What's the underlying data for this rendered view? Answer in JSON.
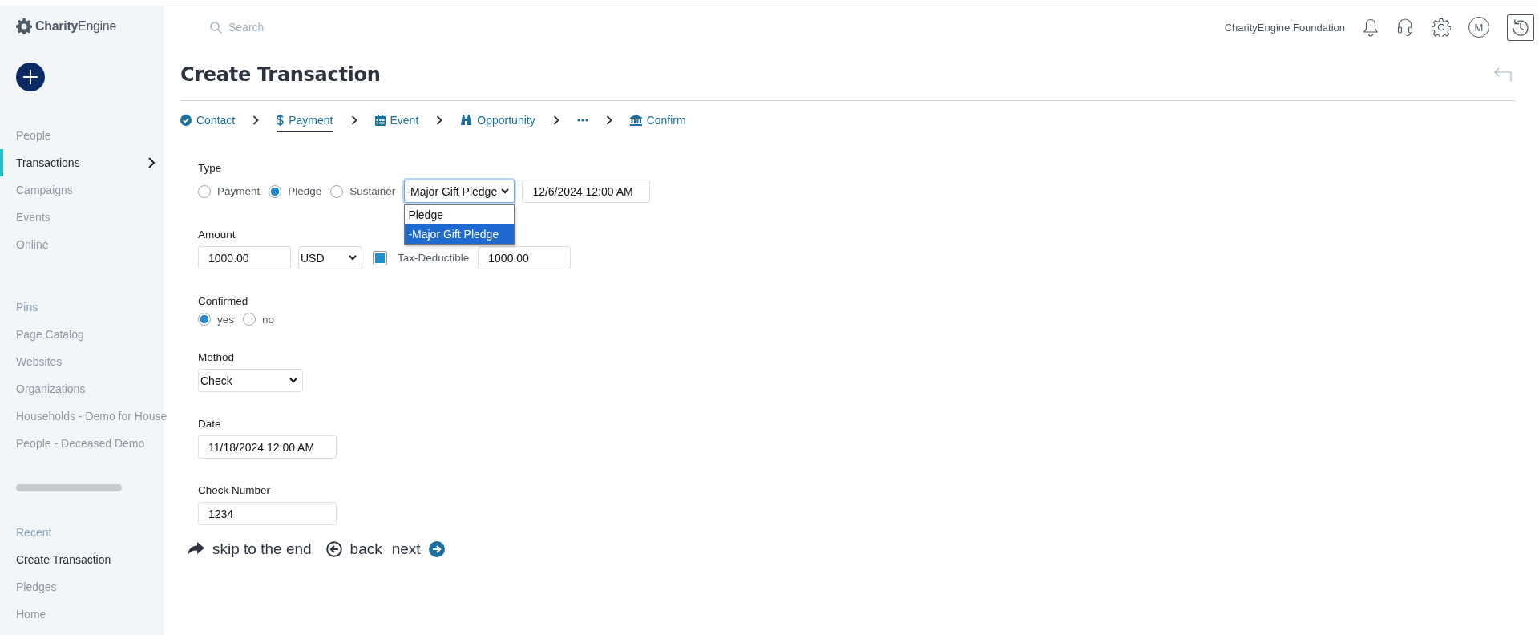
{
  "sidebar": {
    "logo": "**Charity**Engine",
    "nav_items": [
      {
        "label": "People",
        "selected": false
      },
      {
        "label": "Transactions",
        "selected": true
      },
      {
        "label": "Campaigns",
        "selected": false
      },
      {
        "label": "Events",
        "selected": false
      },
      {
        "label": "Online",
        "selected": false
      }
    ],
    "pins_heading": "Pins",
    "pins": [
      {
        "label": "Page Catalog",
        "selected": false
      },
      {
        "label": "Websites",
        "selected": false
      },
      {
        "label": "Organizations",
        "selected": false
      },
      {
        "label": "Households - Demo for House",
        "selected": false
      },
      {
        "label": "People - Deceased Demo",
        "selected": false
      }
    ],
    "recent_heading": "Recent",
    "recent": [
      {
        "label": "Create Transaction",
        "selected": true
      },
      {
        "label": "Pledges",
        "selected": false
      },
      {
        "label": "Home",
        "selected": false
      }
    ]
  },
  "topbar": {
    "search_placeholder": "Search",
    "organization": "CharityEngine Foundation",
    "avatar": "M"
  },
  "page": {
    "title": "Create Transaction"
  },
  "steps": [
    {
      "kind": "check",
      "label": "Contact",
      "selected": false
    },
    {
      "kind": "dollar",
      "label": "Payment",
      "selected": true
    },
    {
      "kind": "calendar",
      "label": "Event",
      "selected": false
    },
    {
      "kind": "binoculars",
      "label": "Opportunity",
      "selected": false
    },
    {
      "kind": "more",
      "selected": false
    },
    {
      "kind": "bank",
      "label": "Confirm",
      "selected": false
    }
  ],
  "form": {
    "type": {
      "label": "Type",
      "options": [
        {
          "label": "Payment",
          "selected": false
        },
        {
          "label": "Pledge",
          "selected": true
        },
        {
          "label": "Sustainer",
          "selected": false
        }
      ],
      "subtype": {
        "value": "-Major Gift Pledge",
        "expanded": true,
        "options": [
          {
            "label": "Pledge",
            "selected": false
          },
          {
            "label": "-Major Gift Pledge",
            "selected": true
          }
        ]
      },
      "date": "12/6/2024 12:00 AM"
    },
    "amount": {
      "label": "Amount",
      "value": "1000.00",
      "currency": "USD",
      "tax_deductible": {
        "label": "Tax-Deductible",
        "checked": true,
        "value": "1000.00"
      }
    },
    "confirmed": {
      "label": "Confirmed",
      "options": [
        {
          "label": "yes",
          "selected": true
        },
        {
          "label": "no",
          "selected": false
        }
      ]
    },
    "method": {
      "label": "Method",
      "value": "Check"
    },
    "date": {
      "label": "Date",
      "value": "11/18/2024 12:00 AM"
    },
    "check_number": {
      "label": "Check Number",
      "value": "1234"
    }
  },
  "actions": [
    {
      "kind": "skip",
      "label": "skip to the end"
    },
    {
      "kind": "back",
      "label": "back"
    },
    {
      "kind": "next",
      "label": "next"
    }
  ]
}
